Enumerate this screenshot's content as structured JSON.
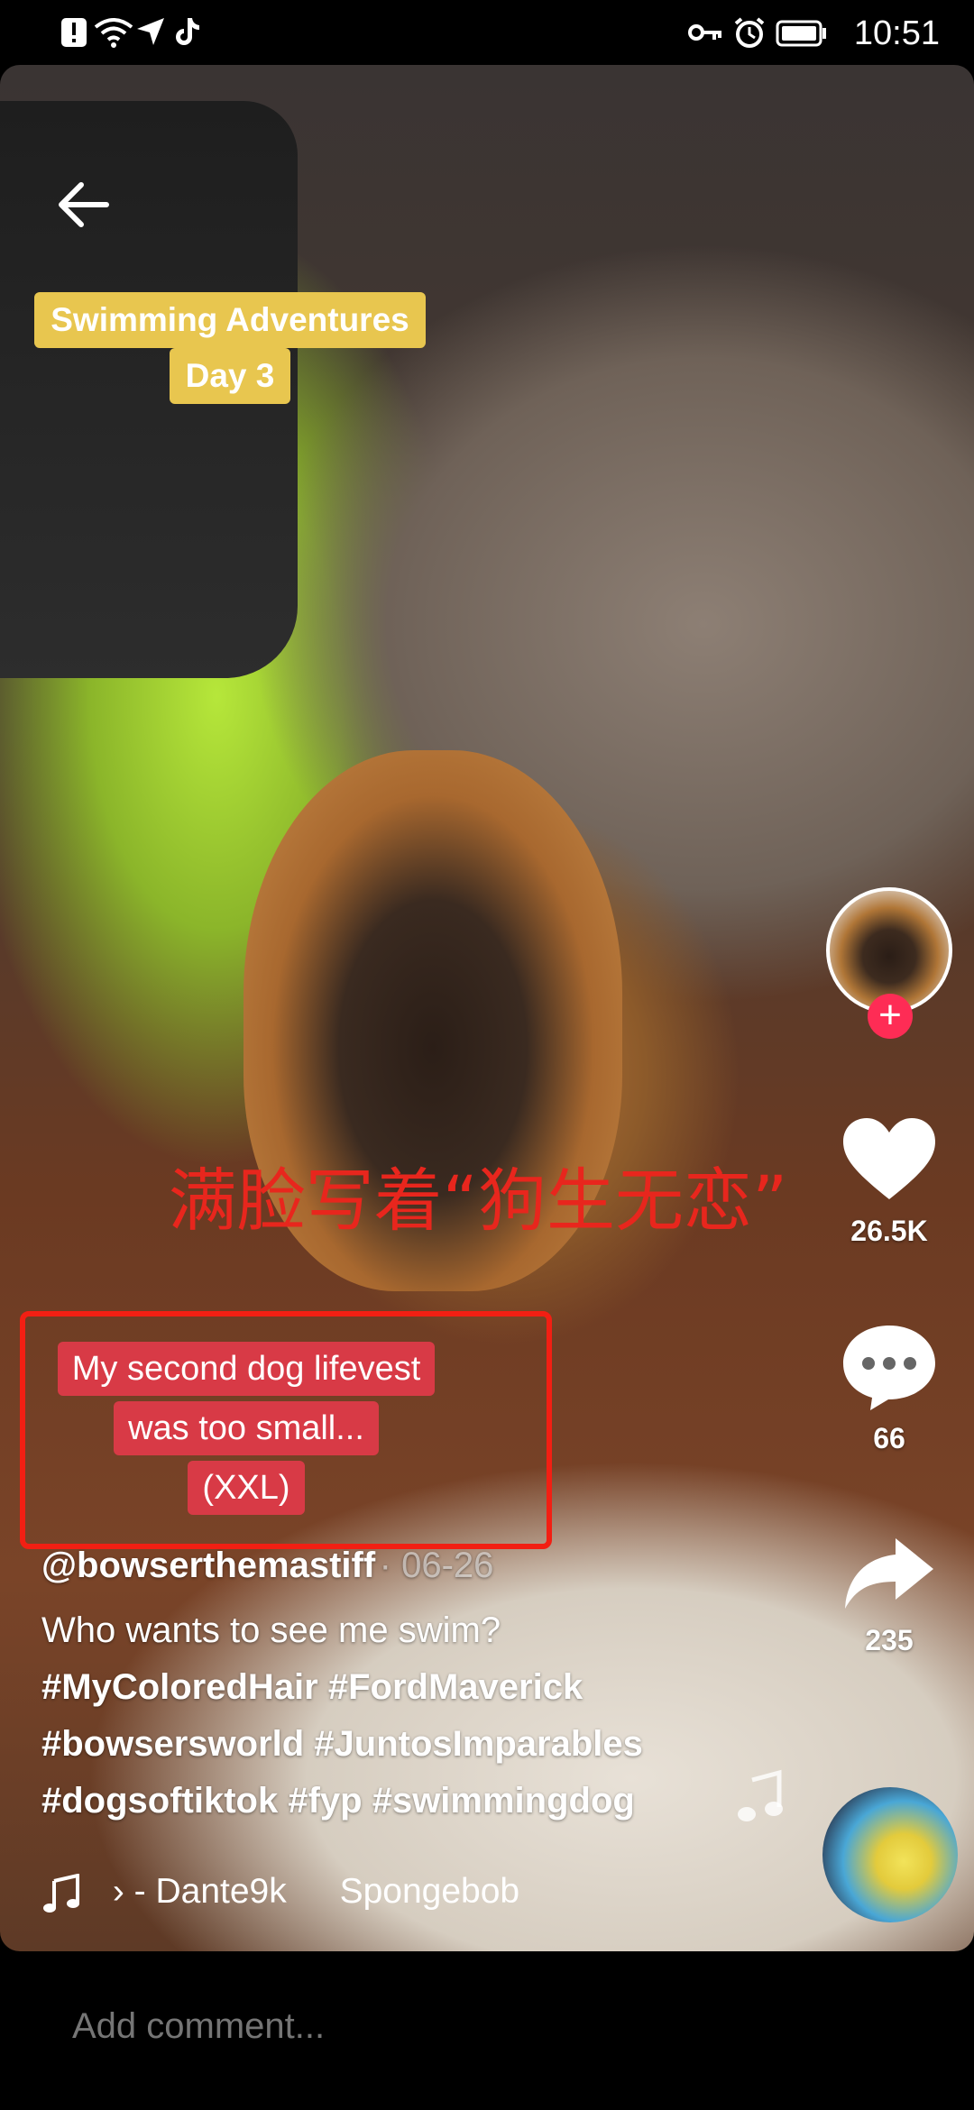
{
  "status_bar": {
    "time": "10:51",
    "icons": [
      "alert-icon",
      "wifi-icon",
      "location-icon",
      "tiktok-icon",
      "key-icon",
      "alarm-icon",
      "battery-icon"
    ]
  },
  "video": {
    "sticker_top": {
      "line1": "Swimming Adventures",
      "line2": "Day 3"
    },
    "chinese_caption": "满脸写着“狗生无恋”",
    "sticker_red": {
      "line1": "My second dog lifevest",
      "line2": "was too small...",
      "line3": "(XXL)"
    }
  },
  "rail": {
    "likes": "26.5K",
    "comments": "66",
    "shares": "235"
  },
  "post": {
    "username": "@bowserthemastiff",
    "date": "· 06-26",
    "description": "Who wants to see me swim?",
    "hashtags_line1": "#MyColoredHair #FordMaverick",
    "hashtags_line2": "#bowsersworld #JuntosImparables",
    "hashtags_line3": "#dogsoftiktok #fyp #swimmingdog"
  },
  "music": {
    "segment1": "› - Dante9k",
    "segment2": "Spongebob"
  },
  "comment": {
    "placeholder": "Add comment..."
  },
  "colors": {
    "like_accent": "#fe2c55",
    "highlight_box": "#f21f13",
    "sticker_yellow": "#e8c64f",
    "sticker_red": "#d83a46"
  }
}
